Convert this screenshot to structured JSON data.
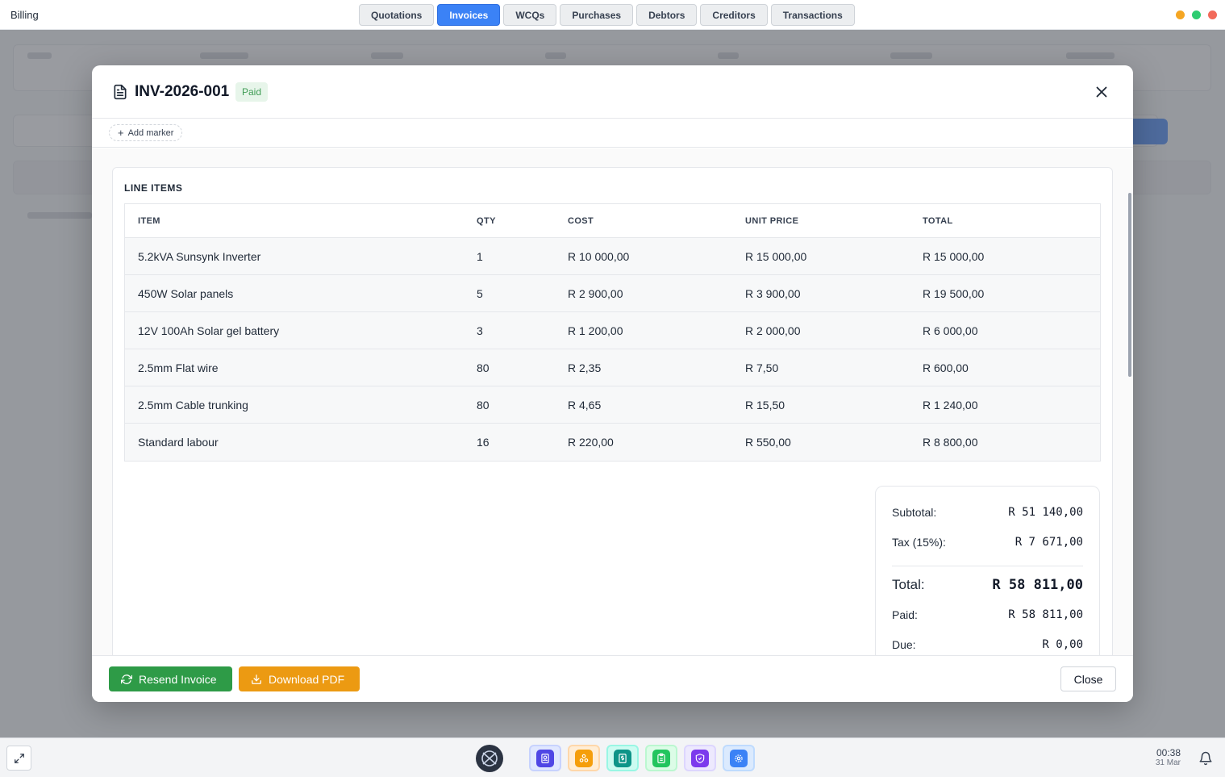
{
  "app": {
    "title": "Billing"
  },
  "nav": {
    "tabs": [
      {
        "label": "Quotations",
        "active": false
      },
      {
        "label": "Invoices",
        "active": true
      },
      {
        "label": "WCQs",
        "active": false
      },
      {
        "label": "Purchases",
        "active": false
      },
      {
        "label": "Debtors",
        "active": false
      },
      {
        "label": "Creditors",
        "active": false
      },
      {
        "label": "Transactions",
        "active": false
      }
    ]
  },
  "modal": {
    "title": "INV-2026-001",
    "status": "Paid",
    "add_marker_label": "Add marker",
    "section_title": "LINE ITEMS",
    "columns": [
      "ITEM",
      "QTY",
      "COST",
      "UNIT PRICE",
      "TOTAL"
    ],
    "rows": [
      {
        "item": "5.2kVA Sunsynk Inverter",
        "qty": "1",
        "cost": "R 10 000,00",
        "unit_price": "R 15 000,00",
        "total": "R 15 000,00"
      },
      {
        "item": "450W Solar panels",
        "qty": "5",
        "cost": "R 2 900,00",
        "unit_price": "R 3 900,00",
        "total": "R 19 500,00"
      },
      {
        "item": "12V 100Ah Solar gel battery",
        "qty": "3",
        "cost": "R 1 200,00",
        "unit_price": "R 2 000,00",
        "total": "R 6 000,00"
      },
      {
        "item": "2.5mm Flat wire",
        "qty": "80",
        "cost": "R 2,35",
        "unit_price": "R 7,50",
        "total": "R 600,00"
      },
      {
        "item": "2.5mm Cable trunking",
        "qty": "80",
        "cost": "R 4,65",
        "unit_price": "R 15,50",
        "total": "R 1 240,00"
      },
      {
        "item": "Standard labour",
        "qty": "16",
        "cost": "R 220,00",
        "unit_price": "R 550,00",
        "total": "R 8 800,00"
      }
    ],
    "totals": {
      "subtotal_label": "Subtotal:",
      "subtotal": "R 51 140,00",
      "tax_label": "Tax (15%):",
      "tax": "R 7 671,00",
      "total_label": "Total:",
      "total": "R 58 811,00",
      "paid_label": "Paid:",
      "paid": "R 58 811,00",
      "due_label": "Due:",
      "due": "R 0,00"
    },
    "footer": {
      "resend_label": "Resend Invoice",
      "download_label": "Download PDF",
      "close_label": "Close"
    }
  },
  "taskbar": {
    "time": "00:38",
    "date": "31 Mar",
    "dock_icons": [
      "contacts-icon",
      "network-icon",
      "billing-icon",
      "clipboard-icon",
      "shield-icon",
      "settings-icon"
    ]
  },
  "colors": {
    "accent": "#3b82f6",
    "success": "#2e9b47",
    "warning": "#ec9a12",
    "paid_badge_bg": "#e7f5ea",
    "paid_badge_text": "#3f9c55"
  }
}
